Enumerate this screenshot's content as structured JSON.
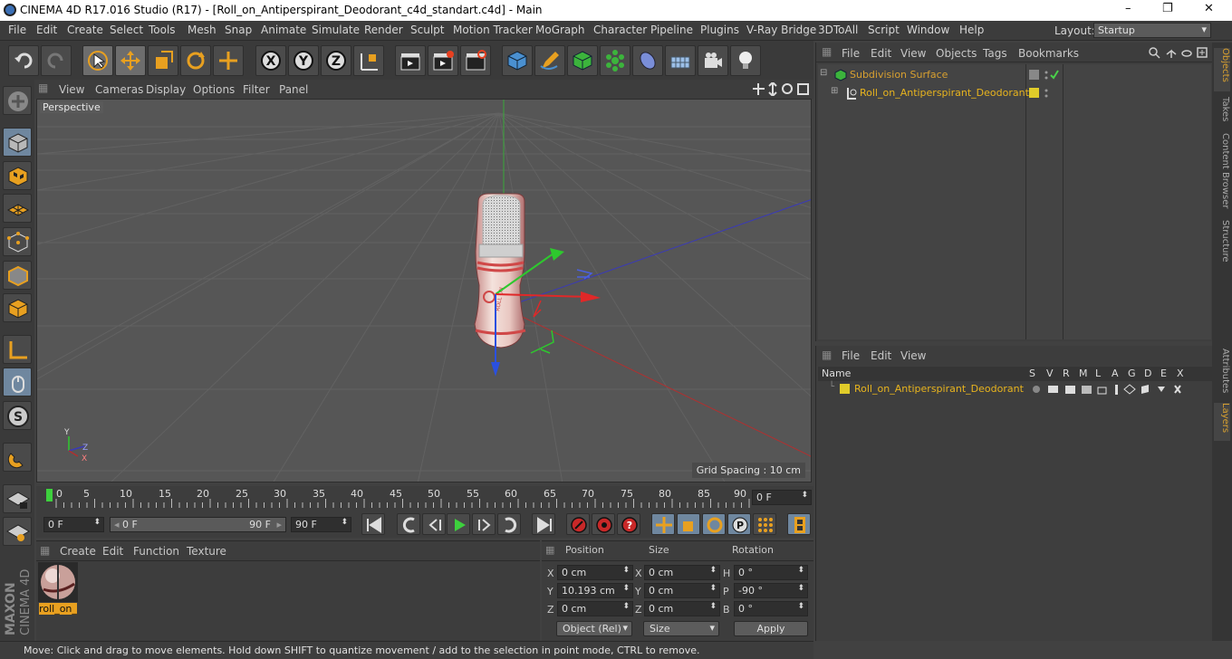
{
  "window": {
    "title": "CINEMA 4D R17.016 Studio (R17) - [Roll_on_Antiperspirant_Deodorant_c4d_standart.c4d] - Main",
    "controls": [
      "–",
      "❐",
      "✕"
    ]
  },
  "menu": [
    "File",
    "Edit",
    "Create",
    "Select",
    "Tools",
    "Mesh",
    "Snap",
    "Animate",
    "Simulate",
    "Render",
    "Sculpt",
    "Motion Tracker",
    "MoGraph",
    "Character",
    "Pipeline",
    "Plugins",
    "V-Ray Bridge",
    "3DToAll",
    "Script",
    "Window",
    "Help"
  ],
  "layout": {
    "label": "Layout:",
    "value": "Startup"
  },
  "viewport": {
    "menu": [
      "View",
      "Cameras",
      "Display",
      "Options",
      "Filter",
      "Panel"
    ],
    "label": "Perspective",
    "grid_spacing": "Grid Spacing : 10 cm",
    "axis_labels": {
      "x": "X",
      "y": "Y",
      "z": "Z"
    }
  },
  "timeline": {
    "ticks": [
      "0",
      "5",
      "10",
      "15",
      "20",
      "25",
      "30",
      "35",
      "40",
      "45",
      "50",
      "55",
      "60",
      "65",
      "70",
      "75",
      "80",
      "85",
      "90"
    ],
    "current_frame": "0 F",
    "start_field": "0 F",
    "range_start": "0 F",
    "range_end": "90 F",
    "end_field": "90 F"
  },
  "material_panel": {
    "menu": [
      "Create",
      "Edit",
      "Function",
      "Texture"
    ],
    "materials": [
      {
        "name": "roll_on_"
      }
    ]
  },
  "coordinates": {
    "headers": {
      "position": "Position",
      "size": "Size",
      "rotation": "Rotation"
    },
    "rows": [
      {
        "axis": "X",
        "pos": "0 cm",
        "size_axis": "X",
        "size": "0 cm",
        "rot_axis": "H",
        "rot": "0 °"
      },
      {
        "axis": "Y",
        "pos": "10.193 cm",
        "size_axis": "Y",
        "size": "0 cm",
        "rot_axis": "P",
        "rot": "-90 °"
      },
      {
        "axis": "Z",
        "pos": "0 cm",
        "size_axis": "Z",
        "size": "0 cm",
        "rot_axis": "B",
        "rot": "0 °"
      }
    ],
    "mode": "Object (Rel)",
    "size_mode": "Size",
    "apply": "Apply"
  },
  "status": "Move: Click and drag to move elements. Hold down SHIFT to quantize movement / add to the selection in point mode, CTRL to remove.",
  "objects_panel": {
    "menu": [
      "File",
      "Edit",
      "View",
      "Objects",
      "Tags",
      "Bookmarks"
    ],
    "items": [
      {
        "name": "Subdivision Surface"
      },
      {
        "name": "Roll_on_Antiperspirant_Deodorant"
      }
    ]
  },
  "layers_panel": {
    "menu": [
      "File",
      "Edit",
      "View"
    ],
    "columns": [
      "Name",
      "S",
      "V",
      "R",
      "M",
      "L",
      "A",
      "G",
      "D",
      "E",
      "X"
    ],
    "items": [
      {
        "name": "Roll_on_Antiperspirant_Deodorant"
      }
    ]
  },
  "side_tabs": [
    "Objects",
    "Takes",
    "Content Browser",
    "Structure",
    "Attributes",
    "Layers"
  ],
  "colors": {
    "accent": "#e8b41e",
    "selection": "#6f879f",
    "layer": "#e0cc2a"
  },
  "logo_text": "MAXON CINEMA 4D"
}
